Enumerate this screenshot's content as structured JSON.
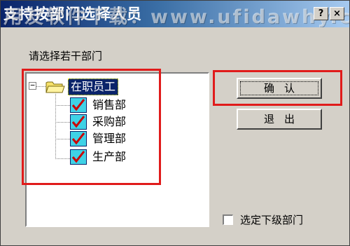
{
  "window": {
    "title": "支持按部门选择人员",
    "watermark": "用友软件下载：www.ufidawhy.com",
    "help_label": "?",
    "close_label": "×"
  },
  "prompt": "请选择若干部门",
  "tree": {
    "root": {
      "label": "在职员工",
      "expanded": true,
      "selected": true,
      "expander_label": "−"
    },
    "children": [
      {
        "label": "销售部",
        "checked": true
      },
      {
        "label": "采购部",
        "checked": true
      },
      {
        "label": "管理部",
        "checked": true
      },
      {
        "label": "生产部",
        "checked": true
      }
    ]
  },
  "buttons": {
    "ok": "确认",
    "exit": "退出"
  },
  "options": {
    "include_subordinate": {
      "label": "选定下级部门",
      "checked": false
    }
  },
  "colors": {
    "highlight": "#e01b1b",
    "selection": "#0a246a",
    "checkbox_fill": "#3fd2e6",
    "check_mark": "#cc0000",
    "dialog_bg": "#d4d0c8"
  }
}
